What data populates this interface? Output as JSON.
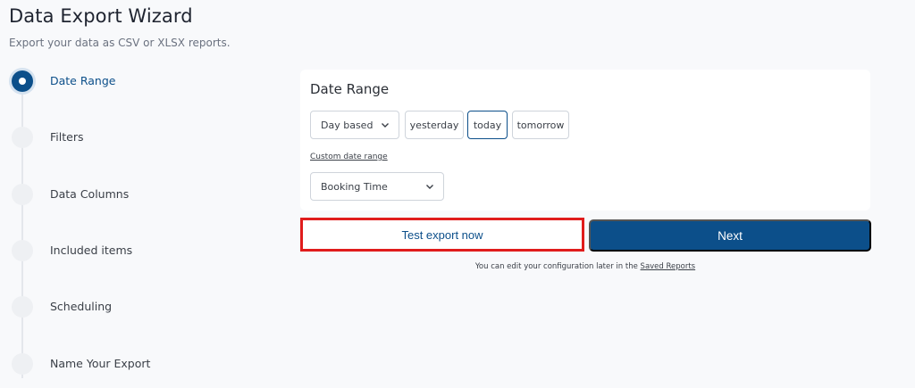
{
  "header": {
    "title": "Data Export Wizard",
    "subtitle": "Export your data as CSV or XLSX reports."
  },
  "stepper": {
    "steps": [
      {
        "label": "Date Range",
        "active": true
      },
      {
        "label": "Filters",
        "active": false
      },
      {
        "label": "Data Columns",
        "active": false
      },
      {
        "label": "Included items",
        "active": false
      },
      {
        "label": "Scheduling",
        "active": false
      },
      {
        "label": "Name Your Export",
        "active": false
      }
    ]
  },
  "date_range": {
    "title": "Date Range",
    "mode_select": "Day based",
    "chips": [
      "yesterday",
      "today",
      "tomorrow"
    ],
    "selected_chip": "today",
    "custom_link": "Custom date range",
    "time_field_select": "Booking Time"
  },
  "actions": {
    "test_export_label": "Test export now",
    "next_label": "Next",
    "footnote_text": "You can edit your configuration later in the ",
    "footnote_link": "Saved Reports"
  },
  "colors": {
    "primary": "#0c4f8a",
    "highlight_border": "#e01c1c",
    "background": "#f8f9fb"
  },
  "icons": {
    "select_arrow": "chevron-down-icon",
    "active_step": "radio-dot-icon"
  }
}
